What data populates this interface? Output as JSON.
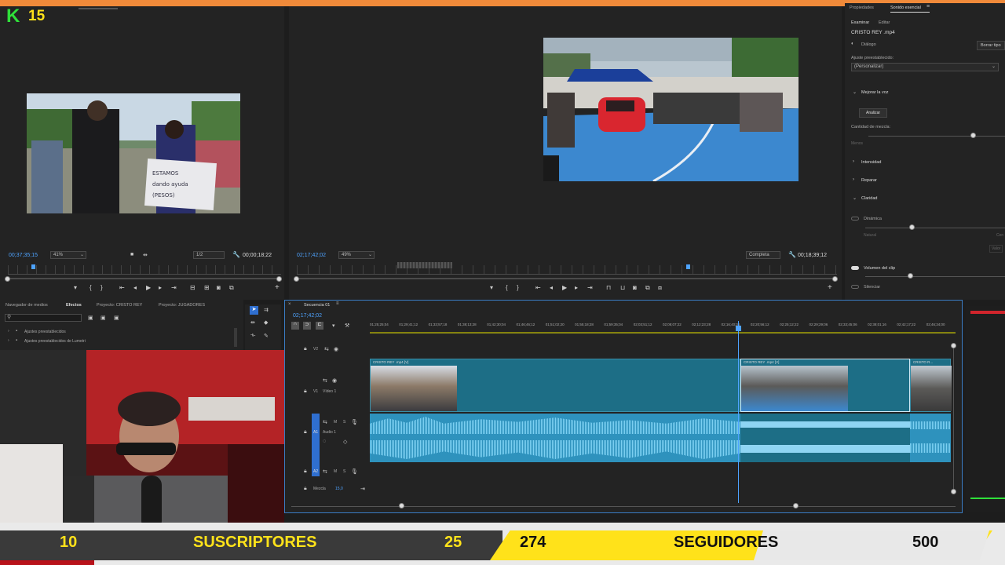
{
  "stream": {
    "logo_letter": "K",
    "logo_number": "15",
    "subscribers_label": "SUSCRIPTORES",
    "subscribers_current": "10",
    "subscribers_goal": "25",
    "followers_current": "274",
    "followers_label": "SEGUIDORES",
    "followers_goal": "500"
  },
  "source_monitor": {
    "timecode": "00;37;35;15",
    "zoom": "41%",
    "resolution": "1/2",
    "duration": "00;00;18;22"
  },
  "program_monitor": {
    "timecode": "02;17;42;02",
    "zoom": "49%",
    "quality": "Completa",
    "duration": "00;18;39;12"
  },
  "essential_sound": {
    "tab_properties": "Propiedades",
    "tab_essential_sound": "Sonido esencial",
    "subtab_browse": "Examinar",
    "subtab_edit": "Editar",
    "clip_name": "CRISTO REY .mp4",
    "type_label": "Diálogo",
    "clear_type_button": "Borrar tipo",
    "preset_label": "Ajuste preestablecido:",
    "preset_value": "(Personalizar)",
    "enhance_speech": "Mejorar la voz",
    "analyze_button": "Analizar",
    "mix_amount": "Cantidad de mezcla:",
    "less_label": "Menos",
    "loudness": "Intensidad",
    "repair": "Reparar",
    "clarity": "Claridad",
    "dynamics": "Dinámica",
    "natural_label": "Natural",
    "focused_label": "Cen",
    "value_label": "Valor",
    "clip_volume": "Volumen del clip",
    "mute": "Silenciar"
  },
  "project_panel": {
    "tabs": [
      "Navegador de medios",
      "Efectos",
      "Proyecto: CRISTO REY",
      "Proyecto: JUGADORES"
    ],
    "items": [
      "Ajustes preestablecidos",
      "Ajustes preestablecidos de Lumetri"
    ]
  },
  "timeline": {
    "sequence_tab": "Secuencia 01",
    "timecode": "02;17;42;02",
    "ruler": [
      "01;25;25;04",
      "01;29;41;12",
      "01;33;57;18",
      "01;38;13;28",
      "01;42;30;04",
      "01;46;46;12",
      "01;51;02;20",
      "01;55;18;28",
      "01;59;35;04",
      "02;03;51;12",
      "02;08;07;22",
      "02;12;23;28",
      "02;16;40;06",
      "02;20;56;12",
      "02;25;12;22",
      "02;29;29;06",
      "02;33;45;06",
      "02;38;01;16",
      "02;42;17;22",
      "02;46;34;00"
    ],
    "tracks": {
      "v2": "V2",
      "v1": "V1",
      "v1_name": "Vídeo 1",
      "a1": "A1",
      "a1_name": "Audio 1",
      "a2": "A2",
      "mix_label": "Mezcla",
      "mix_value": "15,0"
    },
    "clips": [
      "CRISTO REY .mp4 [V]",
      "CRISTO REY .mp4 [V]",
      "CRISTO R..."
    ]
  },
  "icons": {
    "play": "play-icon",
    "search": "search-icon",
    "wrench": "wrench-icon"
  },
  "colors": {
    "accent_orange": "#f08a3a",
    "timeline_blue": "#2e92bd",
    "playhead_blue": "#4ea3ff",
    "banner_yellow": "#ffe21a",
    "logo_green": "#2fe03a"
  }
}
